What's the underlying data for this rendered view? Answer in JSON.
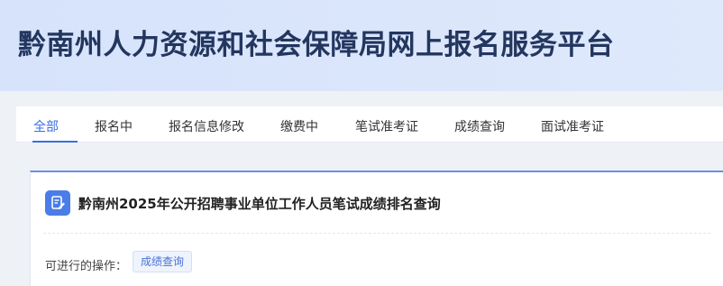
{
  "header": {
    "title": "黔南州人力资源和社会保障局网上报名服务平台"
  },
  "tabs": [
    {
      "label": "全部",
      "active": true
    },
    {
      "label": "报名中"
    },
    {
      "label": "报名信息修改"
    },
    {
      "label": "缴费中"
    },
    {
      "label": "笔试准考证"
    },
    {
      "label": "成绩查询"
    },
    {
      "label": "面试准考证"
    }
  ],
  "card": {
    "icon": "edit-document-icon",
    "title": "黔南州2025年公开招聘事业单位工作人员笔试成绩排名查询",
    "operations_label": "可进行的操作：",
    "operations": [
      {
        "label": "成绩查询"
      }
    ]
  },
  "colors": {
    "accent": "#3a6fe0",
    "banner": "#d6e3fb",
    "title": "#23365f"
  }
}
